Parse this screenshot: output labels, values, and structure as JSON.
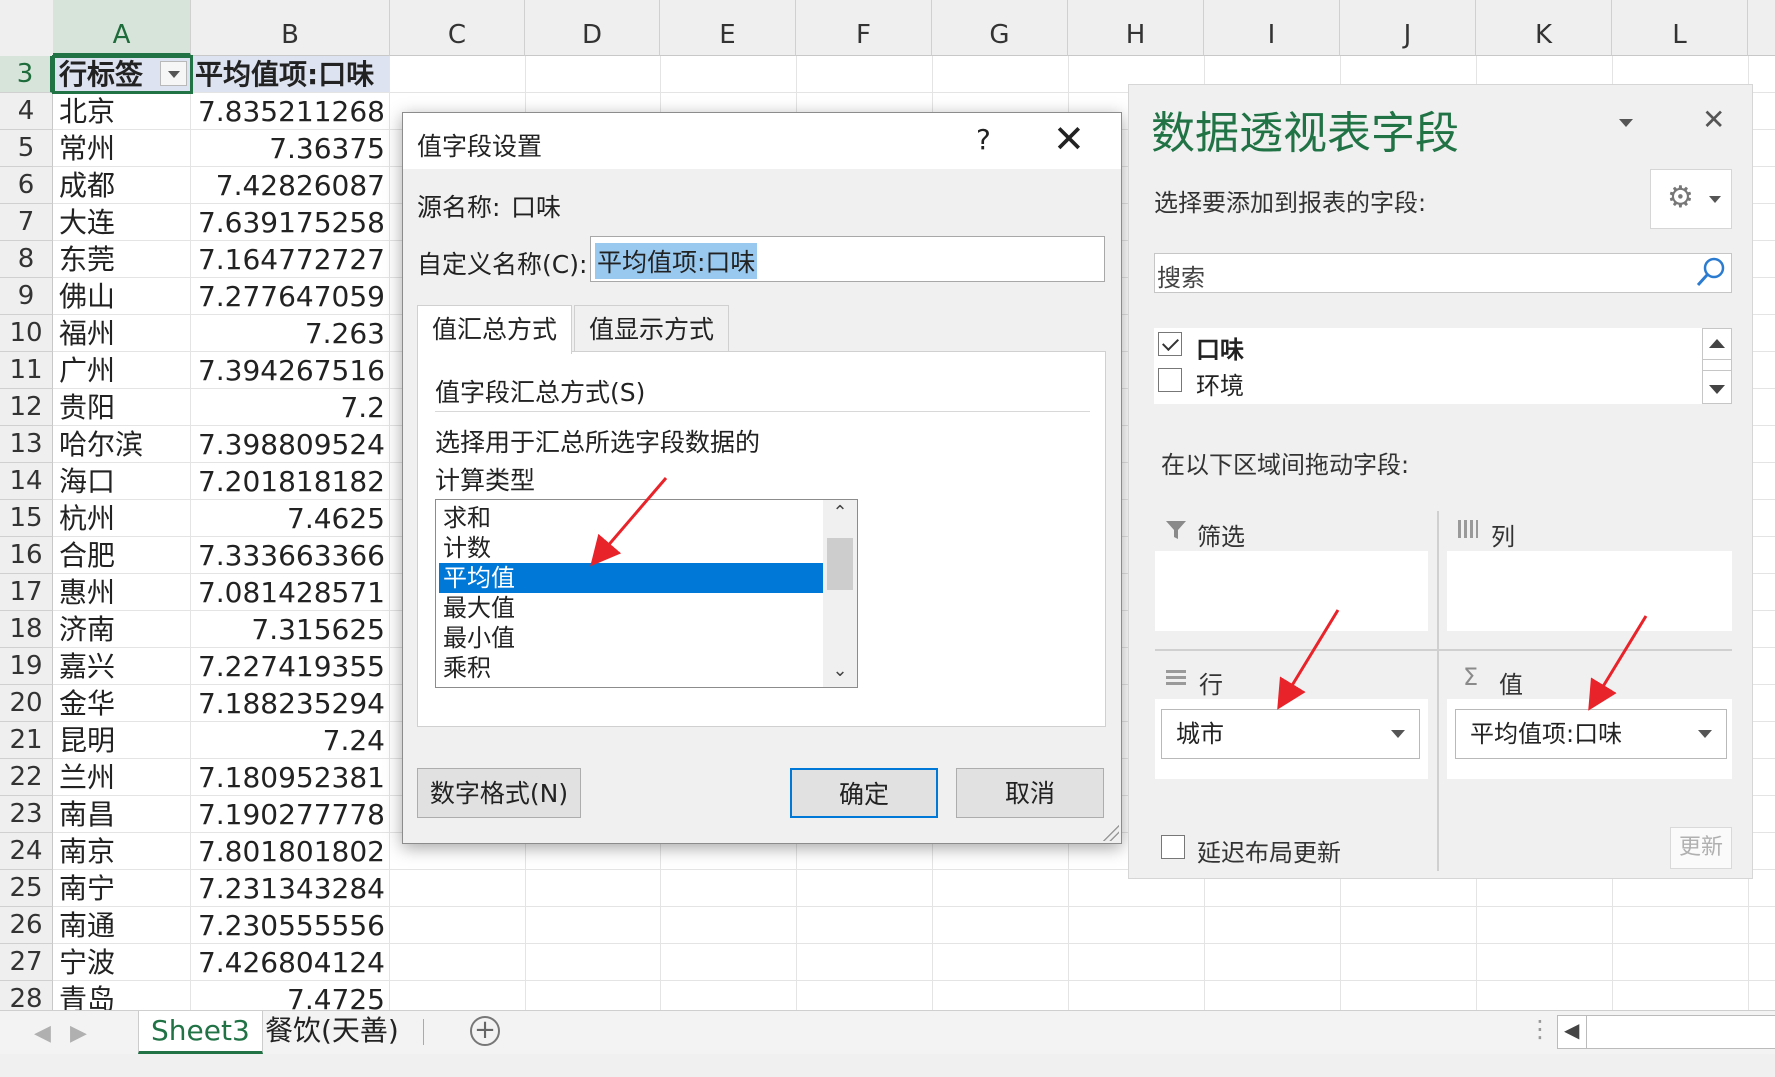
{
  "columns": [
    "A",
    "B",
    "C",
    "D",
    "E",
    "F",
    "G",
    "H",
    "I",
    "J",
    "K",
    "L"
  ],
  "pivot_table": {
    "header_row_num": "3",
    "header": [
      "行标签",
      "平均值项:口味"
    ],
    "rows": [
      {
        "n": "4",
        "city": "北京",
        "val": "7.835211268"
      },
      {
        "n": "5",
        "city": "常州",
        "val": "7.36375"
      },
      {
        "n": "6",
        "city": "成都",
        "val": "7.42826087"
      },
      {
        "n": "7",
        "city": "大连",
        "val": "7.639175258"
      },
      {
        "n": "8",
        "city": "东莞",
        "val": "7.164772727"
      },
      {
        "n": "9",
        "city": "佛山",
        "val": "7.277647059"
      },
      {
        "n": "10",
        "city": "福州",
        "val": "7.263"
      },
      {
        "n": "11",
        "city": "广州",
        "val": "7.394267516"
      },
      {
        "n": "12",
        "city": "贵阳",
        "val": "7.2"
      },
      {
        "n": "13",
        "city": "哈尔滨",
        "val": "7.398809524"
      },
      {
        "n": "14",
        "city": "海口",
        "val": "7.201818182"
      },
      {
        "n": "15",
        "city": "杭州",
        "val": "7.4625"
      },
      {
        "n": "16",
        "city": "合肥",
        "val": "7.333663366"
      },
      {
        "n": "17",
        "city": "惠州",
        "val": "7.081428571"
      },
      {
        "n": "18",
        "city": "济南",
        "val": "7.315625"
      },
      {
        "n": "19",
        "city": "嘉兴",
        "val": "7.227419355"
      },
      {
        "n": "20",
        "city": "金华",
        "val": "7.188235294"
      },
      {
        "n": "21",
        "city": "昆明",
        "val": "7.24"
      },
      {
        "n": "22",
        "city": "兰州",
        "val": "7.180952381"
      },
      {
        "n": "23",
        "city": "南昌",
        "val": "7.190277778"
      },
      {
        "n": "24",
        "city": "南京",
        "val": "7.801801802"
      },
      {
        "n": "25",
        "city": "南宁",
        "val": "7.231343284"
      },
      {
        "n": "26",
        "city": "南通",
        "val": "7.230555556"
      },
      {
        "n": "27",
        "city": "宁波",
        "val": "7.426804124"
      },
      {
        "n": "28",
        "city": "青岛",
        "val": "7.4725"
      }
    ]
  },
  "sheet_tabs": {
    "active": "Sheet3",
    "other": "餐饮(天善)",
    "prev_icon": "triangle-left-icon",
    "next_icon": "triangle-right-icon",
    "add_icon": "plus-circle-icon"
  },
  "dialog": {
    "title": "值字段设置",
    "help": "?",
    "close": "✕",
    "source_label": "源名称:",
    "source_value": "口味",
    "custom_name_label": "自定义名称(C):",
    "custom_name_value": "平均值项:口味",
    "tabs": [
      "值汇总方式",
      "值显示方式"
    ],
    "section_title": "值字段汇总方式(S)",
    "description_line1": "选择用于汇总所选字段数据的",
    "description_line2": "计算类型",
    "functions": [
      "求和",
      "计数",
      "平均值",
      "最大值",
      "最小值",
      "乘积"
    ],
    "selected_function": "平均值",
    "number_format_button": "数字格式(N)",
    "ok_button": "确定",
    "cancel_button": "取消"
  },
  "pivot_panel": {
    "title": "数据透视表字段",
    "choose_label": "选择要添加到报表的字段:",
    "search_placeholder": "搜索",
    "fields": [
      {
        "name": "口味",
        "checked": true
      },
      {
        "name": "环境",
        "checked": false
      }
    ],
    "drag_label": "在以下区域间拖动字段:",
    "areas": {
      "filter": "筛选",
      "columns": "列",
      "rows": "行",
      "values": "值"
    },
    "rows_field": "城市",
    "values_field": "平均值项:口味",
    "defer_label": "延迟布局更新",
    "update_button": "更新",
    "icons": [
      "settings-gear-icon",
      "search-icon",
      "close-icon",
      "filter-funnel-icon",
      "columns-icon",
      "rows-icon",
      "sigma-icon"
    ]
  },
  "annotation_color": "#e8232a",
  "accent_color": "#217346"
}
